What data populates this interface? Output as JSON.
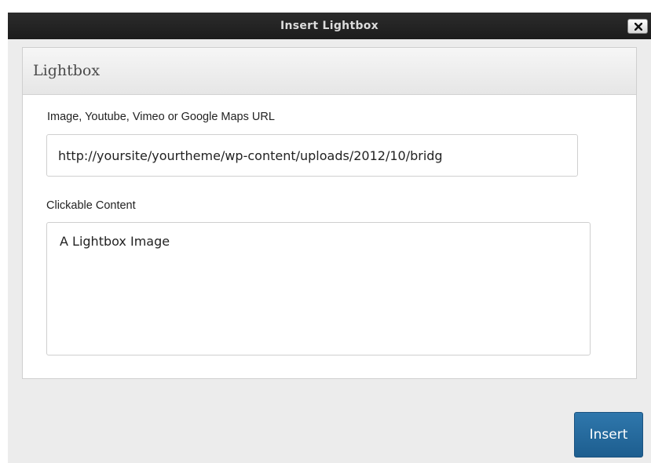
{
  "dialog": {
    "title": "Insert Lightbox",
    "close_icon": "close-icon"
  },
  "panel": {
    "title": "Lightbox"
  },
  "url_field": {
    "label": "Image, Youtube, Vimeo or Google Maps URL",
    "value": "http://yoursite/yourtheme/wp-content/uploads/2012/10/bridg"
  },
  "content_field": {
    "label": "Clickable Content",
    "value": "A Lightbox Image"
  },
  "actions": {
    "insert_label": "Insert"
  },
  "colors": {
    "titlebar": "#1c1c1c",
    "accent": "#2a6fa3",
    "background": "#ececec"
  }
}
